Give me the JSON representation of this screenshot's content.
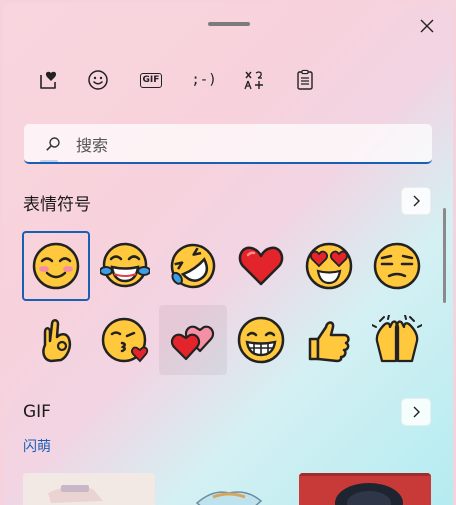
{
  "window": {
    "close_label": "✕"
  },
  "tabs": [
    {
      "name": "tab-emoji-favorites",
      "icon": "emoji-heart-icon",
      "active": true
    },
    {
      "name": "tab-emoji",
      "icon": "smiley-icon",
      "active": false
    },
    {
      "name": "tab-gif",
      "icon": "gif-icon",
      "label": "GIF",
      "active": false
    },
    {
      "name": "tab-kaomoji",
      "icon": "kaomoji-icon",
      "label": ";-)",
      "active": false
    },
    {
      "name": "tab-symbols",
      "icon": "symbols-icon",
      "active": false
    },
    {
      "name": "tab-clipboard",
      "icon": "clipboard-icon",
      "active": false
    }
  ],
  "search": {
    "placeholder": "搜索",
    "value": ""
  },
  "emoji_section": {
    "title": "表情符号",
    "items": [
      {
        "icon": "smiling-face-icon",
        "state": "selected"
      },
      {
        "icon": "tears-of-joy-icon",
        "state": "normal"
      },
      {
        "icon": "rolling-laughing-icon",
        "state": "normal"
      },
      {
        "icon": "red-heart-icon",
        "state": "normal"
      },
      {
        "icon": "heart-eyes-icon",
        "state": "normal"
      },
      {
        "icon": "unamused-face-icon",
        "state": "normal"
      },
      {
        "icon": "ok-hand-icon",
        "state": "normal"
      },
      {
        "icon": "kissing-heart-icon",
        "state": "normal"
      },
      {
        "icon": "two-hearts-icon",
        "state": "hover"
      },
      {
        "icon": "grinning-face-icon",
        "state": "normal"
      },
      {
        "icon": "thumbs-up-icon",
        "state": "normal"
      },
      {
        "icon": "raising-hands-icon",
        "state": "normal"
      }
    ]
  },
  "gif_section": {
    "title": "GIF",
    "subtitle": "闪萌"
  },
  "colors": {
    "accent": "#1a5fb4",
    "emoji_yellow": "#ffc83d",
    "heart_red": "#e3242b"
  }
}
